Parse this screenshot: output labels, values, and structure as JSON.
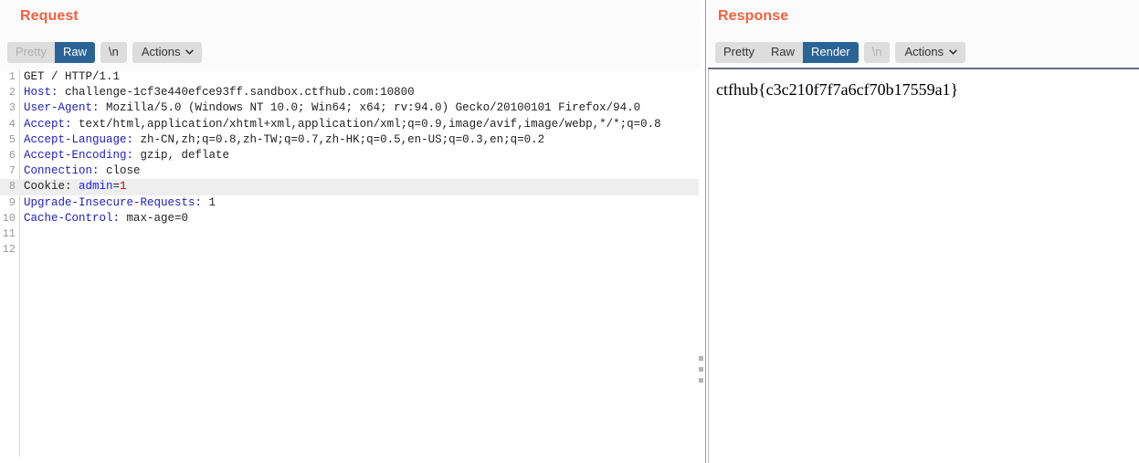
{
  "request": {
    "title": "Request",
    "toolbar": {
      "pretty_label": "Pretty",
      "raw_label": "Raw",
      "newline_label": "\\n",
      "actions_label": "Actions",
      "selected": "Raw",
      "disabled": "Pretty",
      "caret_icon": "chevron-down-icon"
    },
    "lines": [
      {
        "no": "1",
        "text": "GET / HTTP/1.1"
      },
      {
        "no": "2",
        "name": "Host:",
        "value": " challenge-1cf3e440efce93ff.sandbox.ctfhub.com:10800"
      },
      {
        "no": "3",
        "name": "User-Agent:",
        "value": " Mozilla/5.0 (Windows NT 10.0; Win64; x64; rv:94.0) Gecko/20100101 Firefox/94.0"
      },
      {
        "no": "4",
        "name": "Accept:",
        "value": " text/html,application/xhtml+xml,application/xml;q=0.9,image/avif,image/webp,*/*;q=0.8"
      },
      {
        "no": "5",
        "name": "Accept-Language:",
        "value": " zh-CN,zh;q=0.8,zh-TW;q=0.7,zh-HK;q=0.5,en-US;q=0.3,en;q=0.2"
      },
      {
        "no": "6",
        "name": "Accept-Encoding:",
        "value": " gzip, deflate"
      },
      {
        "no": "7",
        "name": "Connection:",
        "value": " close"
      },
      {
        "no": "8",
        "text_prefix": "Cookie: ",
        "cookie_key": "admin",
        "cookie_eq": "=",
        "cookie_value": "1",
        "highlighted": true
      },
      {
        "no": "9",
        "name": "Upgrade-Insecure-Requests:",
        "value": " 1"
      },
      {
        "no": "10",
        "name": "Cache-Control:",
        "value": " max-age=0"
      },
      {
        "no": "11",
        "text": ""
      },
      {
        "no": "12",
        "text": ""
      }
    ]
  },
  "response": {
    "title": "Response",
    "toolbar": {
      "pretty_label": "Pretty",
      "raw_label": "Raw",
      "render_label": "Render",
      "newline_label": "\\n",
      "actions_label": "Actions",
      "selected": "Render",
      "disabled": "\\n",
      "caret_icon": "chevron-down-icon"
    },
    "rendered_text": "ctfhub{c3c210f7f7a6cf70b17559a1}"
  },
  "splitter": {
    "grip_icon": "drag-handle-icon"
  },
  "colors": {
    "title": "#f4603e",
    "selected_tab": "#2a6496",
    "toolbar_bg": "#dddddd",
    "header_name": "#2020c0",
    "cookie_key": "#1a1aff",
    "cookie_value": "#cc0000",
    "row_highlight": "#eeeeee"
  }
}
